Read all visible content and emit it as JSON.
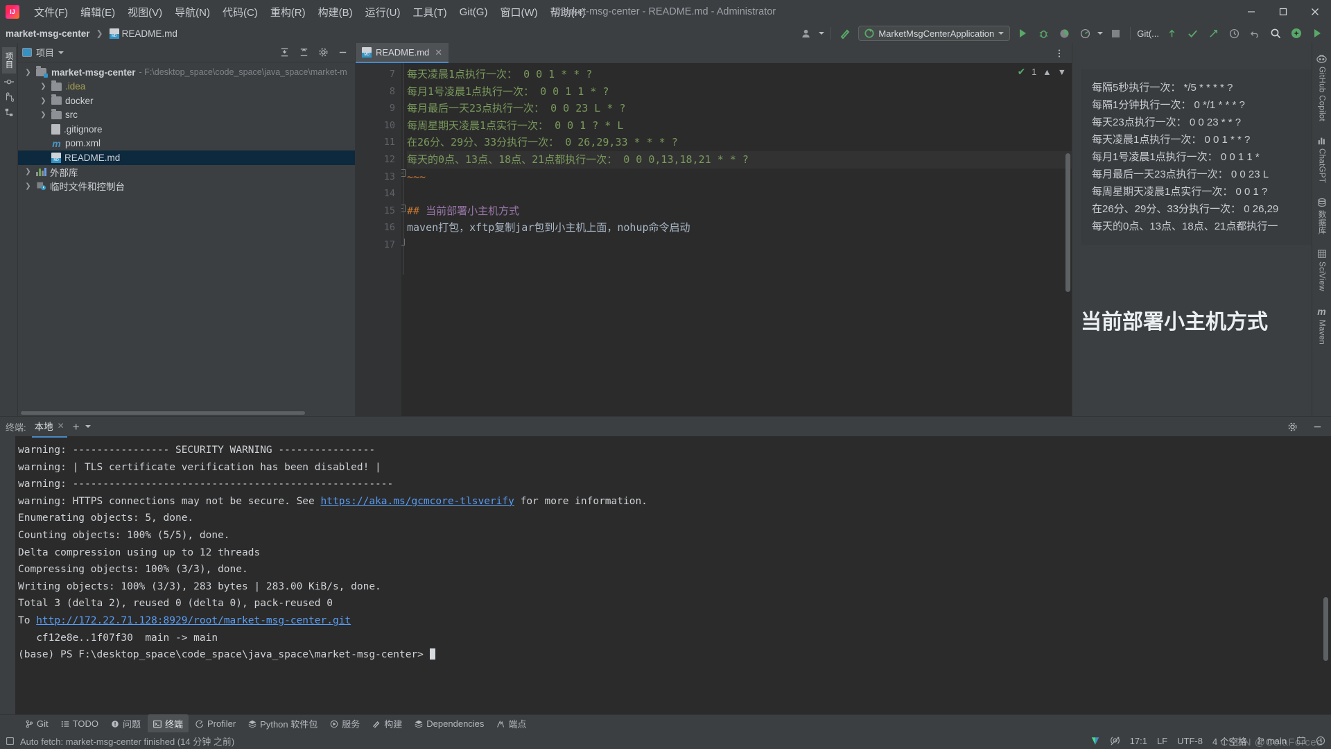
{
  "window": {
    "title": "market-msg-center - README.md - Administrator",
    "minimize": "—",
    "maximize": "❐",
    "close": "✕"
  },
  "menubar": {
    "logo": "ij-logo",
    "items": [
      {
        "label": "文件(F)"
      },
      {
        "label": "编辑(E)"
      },
      {
        "label": "视图(V)"
      },
      {
        "label": "导航(N)"
      },
      {
        "label": "代码(C)"
      },
      {
        "label": "重构(R)"
      },
      {
        "label": "构建(B)"
      },
      {
        "label": "运行(U)"
      },
      {
        "label": "工具(T)"
      },
      {
        "label": "Git(G)"
      },
      {
        "label": "窗口(W)"
      },
      {
        "label": "帮助(H)"
      }
    ]
  },
  "navbar": {
    "breadcrumb": [
      {
        "label": "market-msg-center",
        "icon": "project-icon"
      },
      {
        "label": "README.md",
        "icon": "markdown-file-icon"
      }
    ],
    "run_config": "MarketMsgCenterApplication",
    "git_label": "Git(...",
    "inlay_count": "1"
  },
  "project_panel": {
    "title": "项目",
    "tree": [
      {
        "label": "market-msg-center",
        "path": "- F:\\desktop_space\\code_space\\java_space\\market-m",
        "icon": "module-folder-icon",
        "indent": 0,
        "expanded": true,
        "bold": true
      },
      {
        "label": ".idea",
        "icon": "folder-icon",
        "indent": 1,
        "expanded": false,
        "yellow": true
      },
      {
        "label": "docker",
        "icon": "folder-icon",
        "indent": 1,
        "expanded": false
      },
      {
        "label": "src",
        "icon": "folder-icon",
        "indent": 1,
        "expanded": false
      },
      {
        "label": ".gitignore",
        "icon": "gitignore-file-icon",
        "indent": 2
      },
      {
        "label": "pom.xml",
        "icon": "maven-file-icon",
        "indent": 2
      },
      {
        "label": "README.md",
        "icon": "markdown-file-icon",
        "indent": 2,
        "selected": true
      },
      {
        "label": "外部库",
        "icon": "library-icon",
        "indent": 0,
        "expanded": false
      },
      {
        "label": "临时文件和控制台",
        "icon": "scratches-icon",
        "indent": 0,
        "expanded": false
      }
    ]
  },
  "left_strip": {
    "tabs": [
      {
        "label": "项目",
        "active": true
      },
      {
        "label": "提交"
      },
      {
        "label": "结构"
      }
    ]
  },
  "editor": {
    "tab": {
      "label": "README.md",
      "icon": "markdown-file-icon",
      "close": "✕"
    },
    "lines": [
      {
        "no": "7",
        "fold": "bar",
        "text": "每天凌晨1点执行一次： 0 0 1 * * ?",
        "style": "comment"
      },
      {
        "no": "8",
        "fold": "bar",
        "text": "每月1号凌晨1点执行一次： 0 0 1 1 * ?",
        "style": "comment"
      },
      {
        "no": "9",
        "fold": "bar",
        "text": "每月最后一天23点执行一次： 0 0 23 L * ?",
        "style": "comment"
      },
      {
        "no": "10",
        "fold": "bar",
        "text": "每周星期天凌晨1点实行一次： 0 0 1 ? * L",
        "style": "comment"
      },
      {
        "no": "11",
        "fold": "bar",
        "text": "在26分、29分、33分执行一次： 0 26,29,33 * * * ?",
        "style": "comment"
      },
      {
        "no": "12",
        "fold": "bar",
        "text": "每天的0点、13点、18点、21点都执行一次： 0 0 0,13,18,21 * * ?",
        "style": "comment",
        "highlight": true
      },
      {
        "no": "13",
        "fold": "end",
        "text": "~~~",
        "style": "fence"
      },
      {
        "no": "14",
        "fold": "none",
        "text": "",
        "style": "plain"
      },
      {
        "no": "15",
        "fold": "start",
        "marker": "##",
        "text": " 当前部署小主机方式",
        "style": "heading"
      },
      {
        "no": "16",
        "fold": "none",
        "text": "maven打包，xftp复制jar包到小主机上面，nohup命令启动",
        "style": "body"
      },
      {
        "no": "17",
        "fold": "caret",
        "text": "",
        "style": "plain"
      }
    ]
  },
  "preview": {
    "lines": [
      "每隔5秒执行一次： */5 * * * * ?",
      "每隔1分钟执行一次： 0 */1 * * * ?",
      "每天23点执行一次： 0 0 23 * * ?",
      "每天凌晨1点执行一次： 0 0 1 * * ?",
      "每月1号凌晨1点执行一次： 0 0 1 1 *",
      "每月最后一天23点执行一次： 0 0 23 L",
      "每周星期天凌晨1点实行一次： 0 0 1 ?",
      "在26分、29分、33分执行一次： 0 26,29",
      "每天的0点、13点、18点、21点都执行一"
    ],
    "heading": "当前部署小主机方式"
  },
  "right_strip": {
    "tabs": [
      {
        "label": "GitHub Copilot",
        "icon": "github-copilot-icon"
      },
      {
        "label": "ChatGPT",
        "icon": "chatgpt-icon"
      },
      {
        "label": "数据库",
        "icon": "database-icon"
      },
      {
        "label": "SciView",
        "icon": "sciview-icon"
      },
      {
        "label": "Maven",
        "icon": "maven-icon"
      }
    ]
  },
  "terminal": {
    "label": "终端:",
    "tab": "本地",
    "tab_close": "✕",
    "add": "+",
    "dropdown": "∨",
    "lines": [
      {
        "text": "warning: ---------------- SECURITY WARNING ----------------"
      },
      {
        "text": "warning: | TLS certificate verification has been disabled! |"
      },
      {
        "text": "warning: -----------------------------------------------------"
      },
      {
        "pre": "warning: HTTPS connections may not be secure. See ",
        "link": "https://aka.ms/gcmcore-tlsverify",
        "post": " for more information."
      },
      {
        "text": "Enumerating objects: 5, done."
      },
      {
        "text": "Counting objects: 100% (5/5), done."
      },
      {
        "text": "Delta compression using up to 12 threads"
      },
      {
        "text": "Compressing objects: 100% (3/3), done."
      },
      {
        "text": "Writing objects: 100% (3/3), 283 bytes | 283.00 KiB/s, done."
      },
      {
        "text": "Total 3 (delta 2), reused 0 (delta 0), pack-reused 0"
      },
      {
        "pre": "To ",
        "link": "http://172.22.71.128:8929/root/market-msg-center.git",
        "post": ""
      },
      {
        "text": "   cf12e8e..1f07f30  main -> main"
      },
      {
        "text": "(base) PS F:\\desktop_space\\code_space\\java_space\\market-msg-center> ",
        "cursor": true
      }
    ]
  },
  "toolwindow_bar": {
    "items": [
      {
        "label": "Git",
        "icon": "git-branch-icon"
      },
      {
        "label": "TODO",
        "icon": "todo-icon"
      },
      {
        "label": "问题",
        "icon": "problems-icon"
      },
      {
        "label": "终端",
        "icon": "terminal-icon",
        "active": true
      },
      {
        "label": "Profiler",
        "icon": "profiler-icon"
      },
      {
        "label": "Python 软件包",
        "icon": "python-packages-icon"
      },
      {
        "label": "服务",
        "icon": "services-icon"
      },
      {
        "label": "构建",
        "icon": "build-icon"
      },
      {
        "label": "Dependencies",
        "icon": "dependencies-icon"
      },
      {
        "label": "端点",
        "icon": "endpoints-icon"
      }
    ]
  },
  "statusbar": {
    "message": "Auto fetch: market-msg-center finished (14 分钟 之前)",
    "position": "17:1",
    "line_sep": "LF",
    "encoding": "UTF-8",
    "indent": "4 个空格",
    "branch": "main",
    "watermark": "CSDN @ColaForced"
  },
  "colors": {
    "accent": "#4a88c7",
    "green": "#59a869",
    "selection": "#0d293e",
    "comment_green": "#7a9a5c",
    "orange": "#cc7832",
    "purple": "#9876aa",
    "link": "#589df6"
  }
}
